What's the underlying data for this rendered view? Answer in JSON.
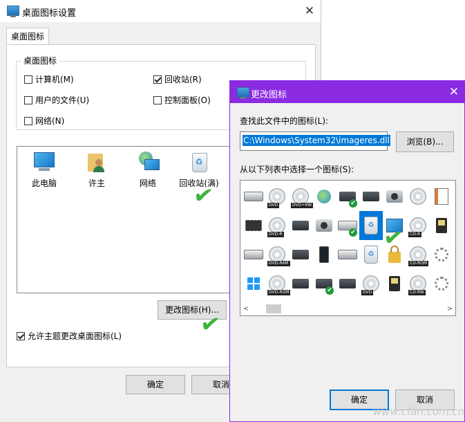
{
  "main_dialog": {
    "title": "桌面图标设置",
    "close": "✕",
    "tab": "桌面图标",
    "group_title": "桌面图标",
    "checkboxes": [
      {
        "label": "计算机(M)",
        "checked": false
      },
      {
        "label": "回收站(R)",
        "checked": true
      },
      {
        "label": "用户的文件(U)",
        "checked": false
      },
      {
        "label": "控制面板(O)",
        "checked": false
      },
      {
        "label": "网络(N)",
        "checked": false
      }
    ],
    "icons": [
      {
        "label": "此电脑",
        "icon": "computer-icon"
      },
      {
        "label": "许主",
        "icon": "user-folder-icon"
      },
      {
        "label": "网络",
        "icon": "network-icon"
      },
      {
        "label": "回收站(满)",
        "icon": "recycle-bin-full-icon"
      }
    ],
    "change_icon_button": "更改图标(H)...",
    "allow_themes": {
      "label": "允许主题更改桌面图标(L)",
      "checked": true
    },
    "ok_button": "确定",
    "cancel_button": "取消"
  },
  "change_icon_dialog": {
    "title": "更改图标",
    "close": "✕",
    "accent_color": "#8a2be2",
    "find_label": "查找此文件中的图标(L):",
    "path_value": "C:\\Windows\\System32\\imageres.dll",
    "browse_button": "浏览(B)...",
    "select_label": "从以下列表中选择一个图标(S):",
    "scroll_left": "<",
    "scroll_right": ">",
    "ok_button": "确定",
    "cancel_button": "取消",
    "disc_tags": {
      "dvd": "DVD",
      "dvd_rw": "DVD+RW",
      "dvd_r": "DVD-R",
      "cd_r": "CD-R",
      "dvd_ram": "DVD-RAM",
      "cd_rom": "CD-ROM",
      "dvd_rom": "DVD-ROM",
      "dvd2": "DVD",
      "cd_rw": "CD-RW"
    }
  },
  "check_mark": "✔",
  "watermark": "www.cfan.com.cn"
}
